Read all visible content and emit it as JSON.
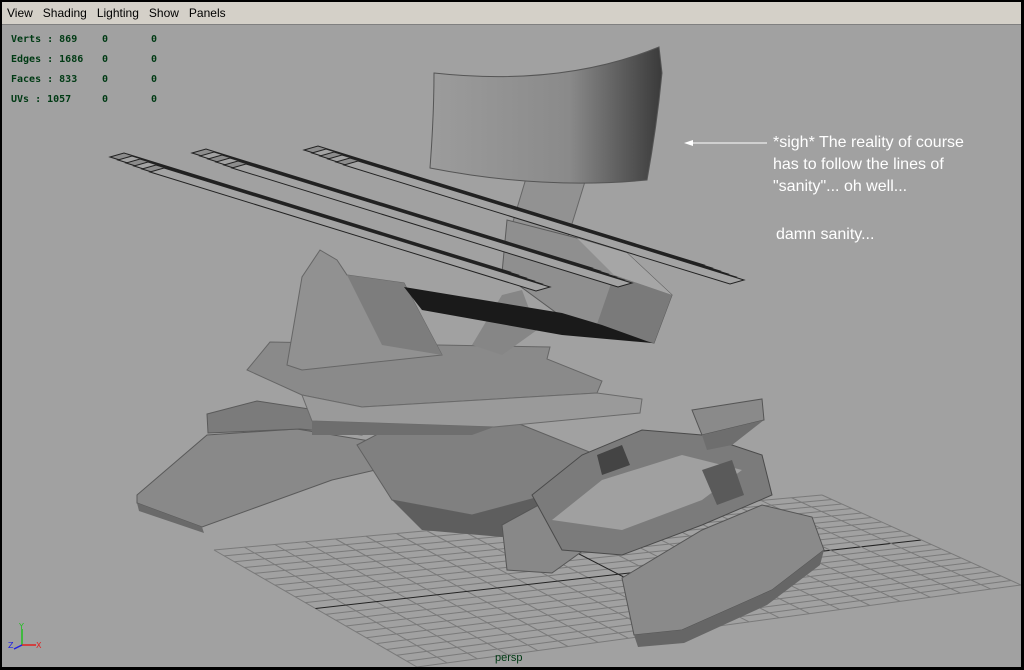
{
  "menu": {
    "items": [
      {
        "label": "View"
      },
      {
        "label": "Shading"
      },
      {
        "label": "Lighting"
      },
      {
        "label": "Show"
      },
      {
        "label": "Panels"
      }
    ]
  },
  "hud": {
    "rows": [
      {
        "label": "Verts : 869",
        "v1": "0",
        "v2": "0"
      },
      {
        "label": "Edges : 1686",
        "v1": "0",
        "v2": "0"
      },
      {
        "label": "Faces : 833",
        "v1": "0",
        "v2": "0"
      },
      {
        "label": "UVs  : 1057",
        "v1": "0",
        "v2": "0"
      }
    ]
  },
  "annotation": {
    "lines": [
      "*sigh* The reality of course",
      "has to follow the lines of",
      "\"sanity\"... oh well..."
    ],
    "note": "damn sanity..."
  },
  "camera": {
    "label": "persp"
  },
  "axis": {
    "x_label": "X",
    "y_label": "Y",
    "z_label": "Z"
  },
  "colors": {
    "viewport_bg": "#a1a1a1",
    "hud_text": "#003a14",
    "annotation_text": "#ffffff",
    "menubar_bg": "#d4d0c8"
  }
}
